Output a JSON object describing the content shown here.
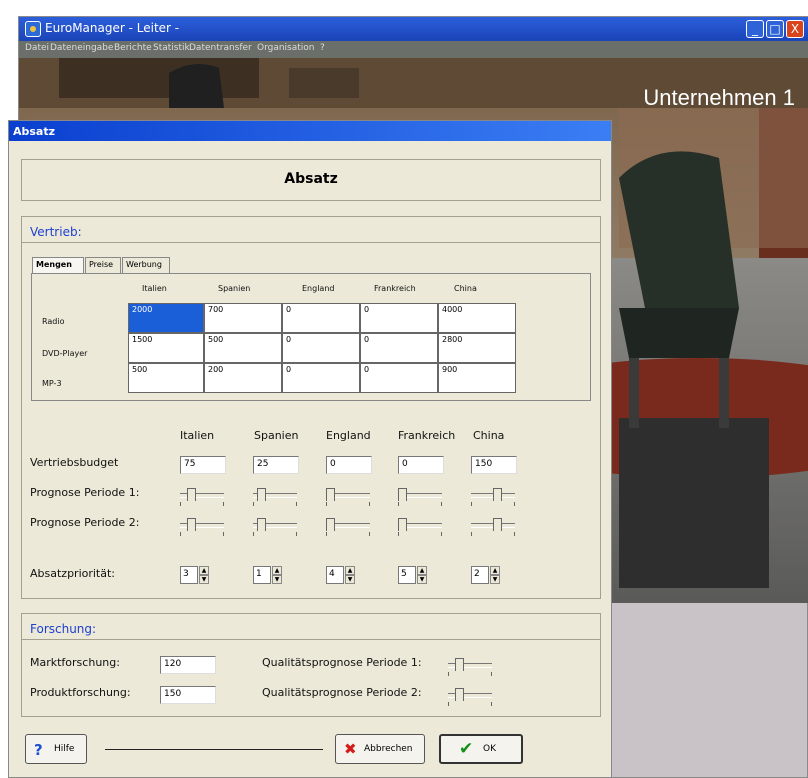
{
  "main_window": {
    "title": "EuroManager - Leiter -",
    "menu": [
      "Datei",
      "Dateneingabe",
      "Berichte",
      "Statistik",
      "Datentransfer",
      "Organisation",
      "?"
    ],
    "window_buttons": [
      "_",
      "□",
      "X"
    ],
    "company_label": "Unternehmen 1"
  },
  "dialog": {
    "title": "Absatz",
    "header": "Absatz",
    "vertrieb": {
      "title": "Vertrieb:",
      "tabs": [
        "Mengen",
        "Preise",
        "Werbung"
      ],
      "grid": {
        "columns": [
          "Italien",
          "Spanien",
          "England",
          "Frankreich",
          "China"
        ],
        "rows": [
          {
            "label": "Radio",
            "values": [
              "2000",
              "700",
              "0",
              "0",
              "4000"
            ]
          },
          {
            "label": "DVD-Player",
            "values": [
              "1500",
              "500",
              "0",
              "0",
              "2800"
            ]
          },
          {
            "label": "MP-3",
            "values": [
              "500",
              "200",
              "0",
              "0",
              "900"
            ]
          }
        ]
      },
      "countries": [
        "Italien",
        "Spanien",
        "England",
        "Frankreich",
        "China"
      ],
      "budget_label": "Vertriebsbudget",
      "budget_values": [
        "75",
        "25",
        "0",
        "0",
        "150"
      ],
      "prognose1_label": "Prognose Periode 1:",
      "prognose2_label": "Prognose Periode 2:",
      "prognose1_levels": [
        0.2,
        0.1,
        0,
        0,
        0.6
      ],
      "prognose2_levels": [
        0.2,
        0.1,
        0,
        0,
        0.6
      ],
      "priority_label": "Absatzpriorität:",
      "priority_values": [
        "3",
        "1",
        "4",
        "5",
        "2"
      ]
    },
    "forschung": {
      "title": "Forschung:",
      "markt_label": "Marktforschung:",
      "markt_value": "120",
      "produkt_label": "Produktforschung:",
      "produkt_value": "150",
      "quality1_label": "Qualitätsprognose Periode 1:",
      "quality2_label": "Qualitätsprognose Periode 2:",
      "quality1_level": 0.2,
      "quality2_level": 0.2
    },
    "buttons": {
      "help": "Hilfe",
      "cancel": "Abbrechen",
      "ok": "OK"
    },
    "colors": {
      "section_title": "#1c3fd1",
      "titlebar": "#0a3fcf",
      "selection": "#1b5fd8"
    }
  }
}
